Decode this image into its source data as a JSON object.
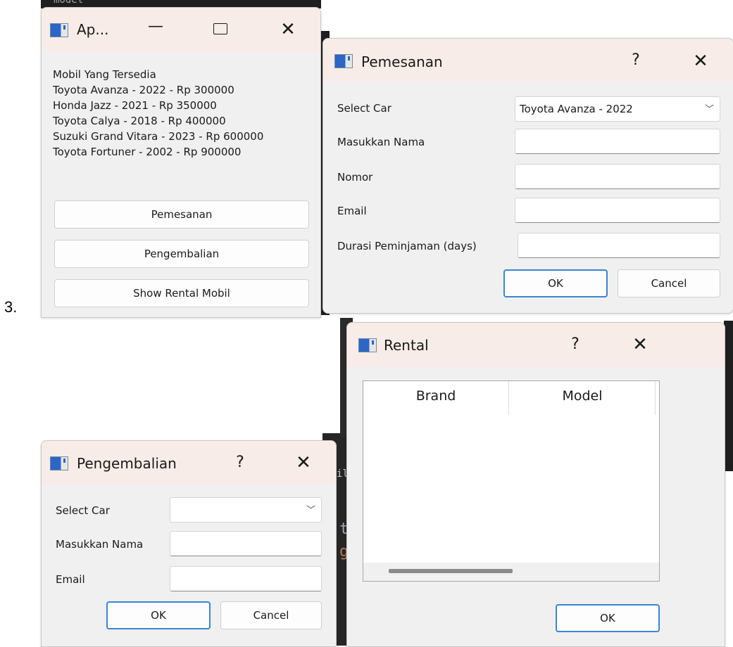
{
  "list_number": "3.",
  "background_snippets": {
    "top_left_code": "model",
    "code_a": "t",
    "code_b": "g",
    "code_c": "il"
  },
  "main_window": {
    "title": "Ap...",
    "heading": "Mobil Yang Tersedia",
    "cars": [
      "Toyota Avanza - 2022 - Rp 300000",
      "Honda Jazz - 2021 - Rp 350000",
      "Toyota Calya - 2018 - Rp 400000",
      "Suzuki Grand Vitara - 2023 - Rp 600000",
      "Toyota Fortuner - 2002 - Rp 900000"
    ],
    "buttons": [
      "Pemesanan",
      "Pengembalian",
      "Show Rental Mobil"
    ]
  },
  "pemesanan_dialog": {
    "title": "Pemesanan",
    "help": "?",
    "fields": {
      "select_car_label": "Select Car",
      "select_car_value": "Toyota Avanza - 2022",
      "nama_label": "Masukkan Nama",
      "nama_value": "",
      "nomor_label": "Nomor",
      "nomor_value": "",
      "email_label": "Email",
      "email_value": "",
      "durasi_label": "Durasi Peminjaman (days)",
      "durasi_value": ""
    },
    "ok_label": "OK",
    "cancel_label": "Cancel"
  },
  "rental_dialog": {
    "title": "Rental",
    "help": "?",
    "columns": [
      "Brand",
      "Model"
    ],
    "ok_label": "OK"
  },
  "pengembalian_dialog": {
    "title": "Pengembalian",
    "help": "?",
    "fields": {
      "select_car_label": "Select Car",
      "select_car_value": "",
      "nama_label": "Masukkan Nama",
      "nama_value": "",
      "email_label": "Email",
      "email_value": ""
    },
    "ok_label": "OK",
    "cancel_label": "Cancel"
  },
  "icons": {
    "app": "window-app-icon",
    "minimize": "minimize-icon",
    "maximize": "maximize-icon",
    "close": "close-icon",
    "dropdown": "chevron-down-icon"
  }
}
